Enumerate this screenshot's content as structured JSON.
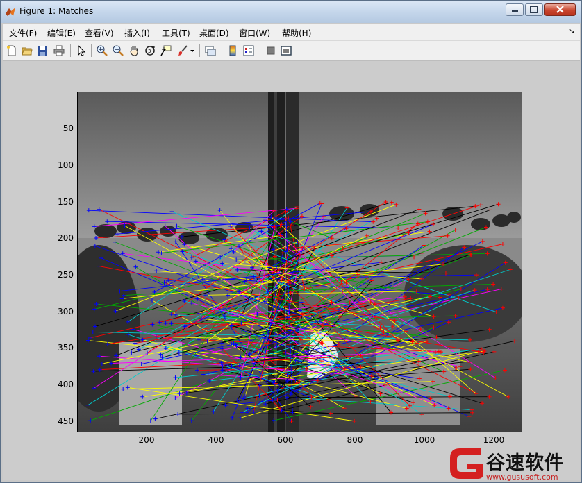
{
  "window": {
    "title": "Figure 1: Matches"
  },
  "menu": {
    "items": [
      "文件(F)",
      "编辑(E)",
      "查看(V)",
      "插入(I)",
      "工具(T)",
      "桌面(D)",
      "窗口(W)",
      "帮助(H)"
    ]
  },
  "toolbar": {
    "icons": [
      "new-figure-icon",
      "open-file-icon",
      "save-icon",
      "print-icon",
      "select-arrow-icon",
      "zoom-in-icon",
      "zoom-out-icon",
      "pan-hand-icon",
      "rotate-3d-icon",
      "data-cursor-icon",
      "brush-icon",
      "brush-dropdown-icon",
      "link-plot-icon",
      "colorbar-icon",
      "legend-icon",
      "hide-plot-tools-icon",
      "show-plot-tools-icon"
    ]
  },
  "axes": {
    "yticks": [
      "50",
      "100",
      "150",
      "200",
      "250",
      "300",
      "350",
      "400",
      "450"
    ],
    "xticks": [
      "200",
      "400",
      "600",
      "800",
      "1000",
      "1200"
    ]
  },
  "chart_data": {
    "type": "scatter",
    "description_units": "pixel coordinates of a stitched grayscale image pair",
    "xlim": [
      1,
      1280
    ],
    "ylim": [
      1,
      465
    ],
    "y_reversed": true,
    "xticks": [
      200,
      400,
      600,
      800,
      1000,
      1200
    ],
    "yticks": [
      50,
      100,
      150,
      200,
      250,
      300,
      350,
      400,
      450
    ],
    "series": [
      {
        "marker": "+",
        "color": "#0000ff"
      },
      {
        "marker": "+",
        "color": "#ff0000"
      }
    ],
    "match_colors": [
      "#ff0000",
      "#0000ff",
      "#00aa00",
      "#ffff00",
      "#ff00ff",
      "#00cccc",
      "#000000"
    ]
  },
  "watermark": {
    "text": "谷速软件",
    "url": "www.gususoft.com",
    "brand_color": "#d42020"
  }
}
